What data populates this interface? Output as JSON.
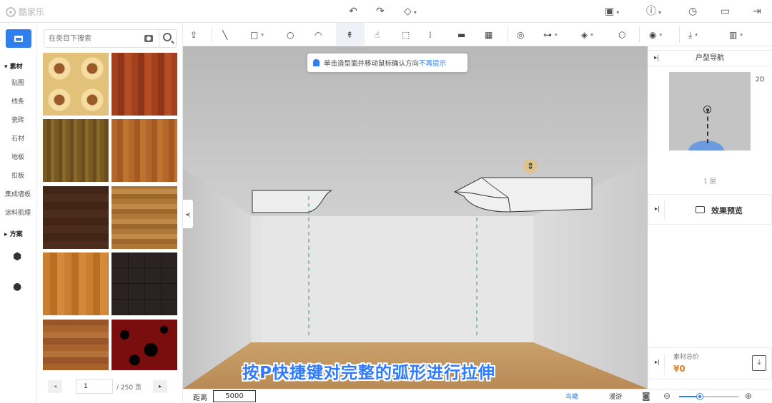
{
  "app": {
    "logo_text": "酷家乐"
  },
  "topbar": {
    "icons": [
      "undo-icon",
      "redo-icon",
      "eraser-icon",
      "save-icon",
      "help-icon",
      "history-icon",
      "file-icon",
      "exit-icon"
    ]
  },
  "rail": {
    "group_material": "素材",
    "items": [
      "贴图",
      "线条",
      "瓷砖",
      "石材",
      "地板",
      "扣板",
      "集成墙板",
      "涂料肌理"
    ],
    "group_scheme": "方案"
  },
  "materials": {
    "search_placeholder": "在类目下搜索",
    "page_current": "1",
    "page_total": "/ 250 页"
  },
  "toolbar": {
    "tools": [
      "upload-icon",
      "line-icon",
      "rectangle-icon",
      "circle-icon",
      "arc-icon",
      "push-pull-icon",
      "gesture-icon",
      "frame-icon",
      "array-icon",
      "panel-icon",
      "grid-icon",
      "target-icon",
      "align-icon",
      "paint-icon",
      "cube-icon",
      "eye-icon",
      "download-icon",
      "map-icon"
    ]
  },
  "viewport": {
    "tip_text": "单击造型面并移动鼠标确认方向",
    "tip_link": "不再提示",
    "caption": "按P快捷键对完整的弧形进行拉伸"
  },
  "nav_panel": {
    "title": "户型导航",
    "mode": "2D",
    "floor": "1 层"
  },
  "preview_panel": {
    "label": "效果预览"
  },
  "price_panel": {
    "label": "素材总价",
    "value": "¥0"
  },
  "bottom": {
    "distance_label": "距离",
    "distance_value": "5000",
    "view_birdseye": "鸟瞰",
    "view_roam": "漫游",
    "zoom_level": 0.35
  },
  "colors": {
    "accent": "#2f80ed",
    "price": "#e67e22",
    "caption": "#2f7bff"
  }
}
